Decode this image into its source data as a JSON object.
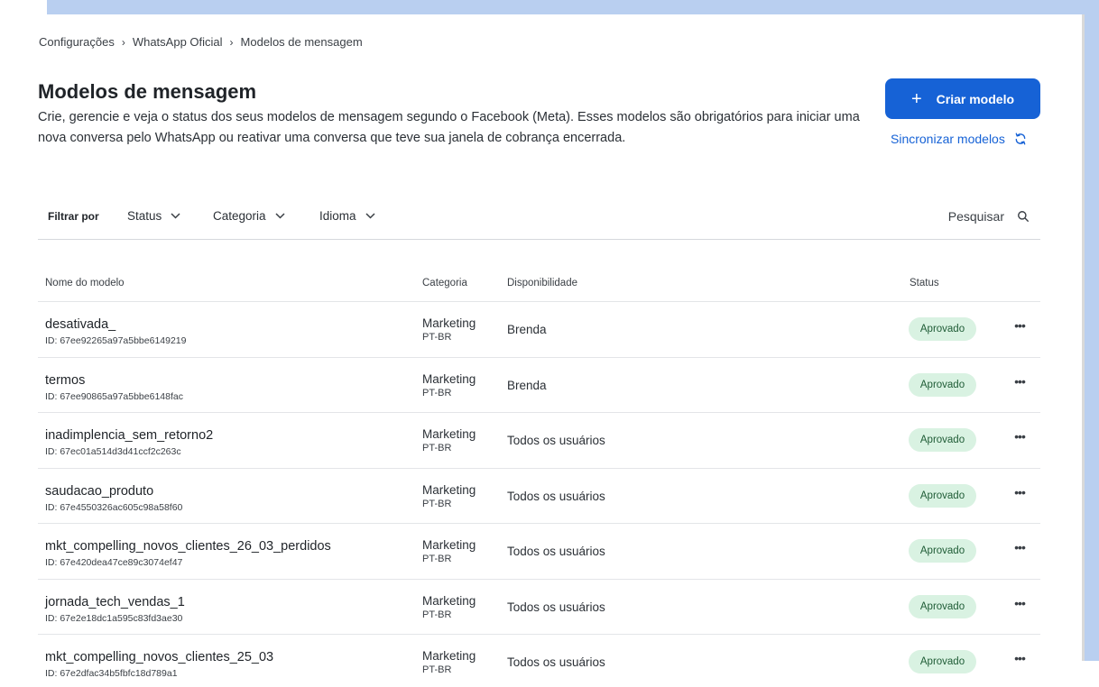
{
  "breadcrumb": {
    "items": [
      "Configurações",
      "WhatsApp Oficial",
      "Modelos de mensagem"
    ],
    "separator": "›"
  },
  "header": {
    "title": "Modelos de mensagem",
    "description": "Crie, gerencie e veja o status dos seus modelos de mensagem segundo o Facebook (Meta). Esses modelos são obrigatórios para iniciar uma nova conversa pelo WhatsApp ou reativar uma conversa que teve sua janela de cobrança encerrada."
  },
  "actions": {
    "create_icon": "+",
    "create_label": "Criar modelo",
    "sync_label": "Sincronizar modelos",
    "sync_icon": "refresh-icon"
  },
  "filters": {
    "label": "Filtrar por",
    "items": [
      "Status",
      "Categoria",
      "Idioma"
    ],
    "search_label": "Pesquisar"
  },
  "table": {
    "columns": [
      "Nome do modelo",
      "Categoria",
      "Disponibilidade",
      "Status"
    ],
    "rows": [
      {
        "name": "desativada_",
        "id": "ID: 67ee92265a97a5bbe6149219",
        "category": "Marketing",
        "language": "PT-BR",
        "availability": "Brenda",
        "status": "Aprovado"
      },
      {
        "name": "termos",
        "id": "ID: 67ee90865a97a5bbe6148fac",
        "category": "Marketing",
        "language": "PT-BR",
        "availability": "Brenda",
        "status": "Aprovado"
      },
      {
        "name": "inadimplencia_sem_retorno2",
        "id": "ID: 67ec01a514d3d41ccf2c263c",
        "category": "Marketing",
        "language": "PT-BR",
        "availability": "Todos os usuários",
        "status": "Aprovado"
      },
      {
        "name": "saudacao_produto",
        "id": "ID: 67e4550326ac605c98a58f60",
        "category": "Marketing",
        "language": "PT-BR",
        "availability": "Todos os usuários",
        "status": "Aprovado"
      },
      {
        "name": "mkt_compelling_novos_clientes_26_03_perdidos",
        "id": "ID: 67e420dea47ce89c3074ef47",
        "category": "Marketing",
        "language": "PT-BR",
        "availability": "Todos os usuários",
        "status": "Aprovado"
      },
      {
        "name": "jornada_tech_vendas_1",
        "id": "ID: 67e2e18dc1a595c83fd3ae30",
        "category": "Marketing",
        "language": "PT-BR",
        "availability": "Todos os usuários",
        "status": "Aprovado"
      },
      {
        "name": "mkt_compelling_novos_clientes_25_03",
        "id": "ID: 67e2dfac34b5fbfc18d789a1",
        "category": "Marketing",
        "language": "PT-BR",
        "availability": "Todos os usuários",
        "status": "Aprovado"
      }
    ],
    "row_menu_icon": "•••"
  },
  "colors": {
    "primary": "#1662d6",
    "badge_bg": "#d9f2e2",
    "badge_text": "#1f5c36",
    "backdrop": "#b9cff0"
  }
}
